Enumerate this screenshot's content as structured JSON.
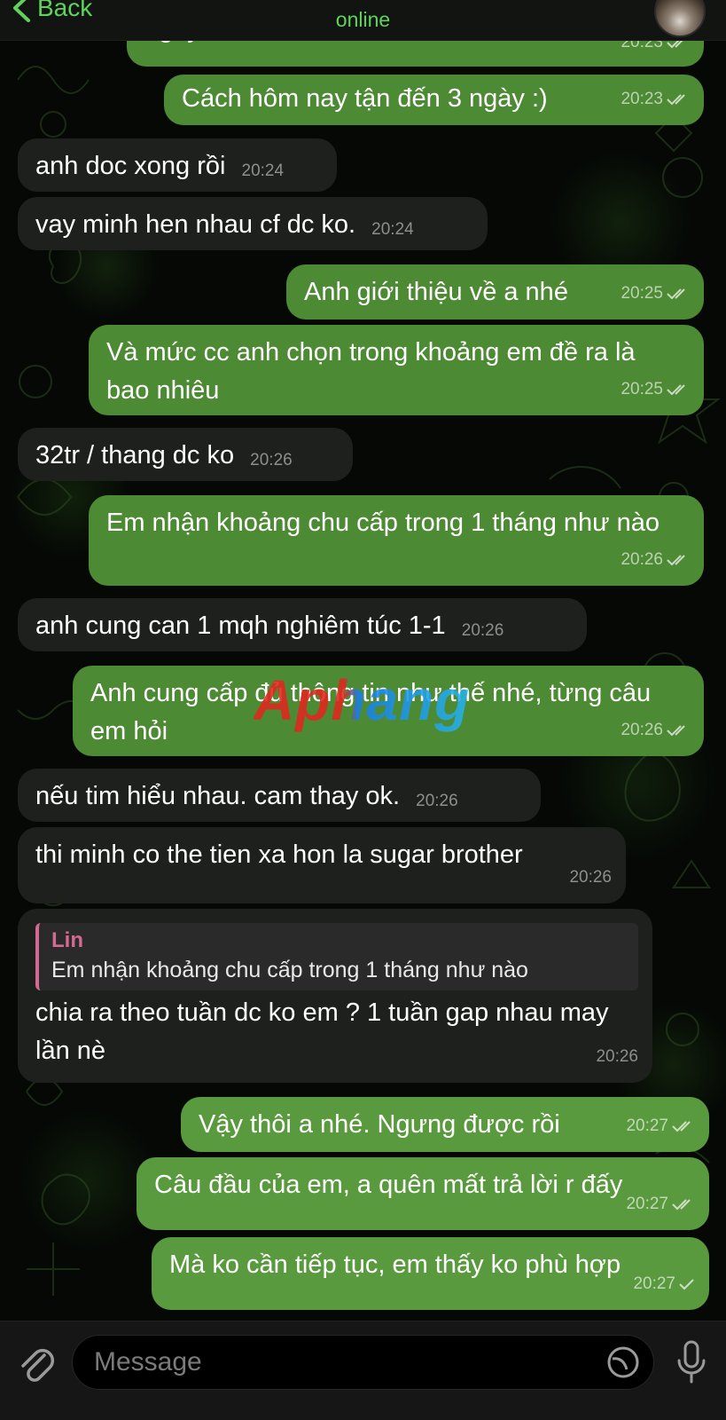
{
  "header": {
    "back_label": "Back",
    "status": "online"
  },
  "messages": [
    {
      "dir": "out",
      "text": "ngày nào nhỉ",
      "time": "20:23",
      "ticks": "double"
    },
    {
      "dir": "out",
      "text": "Cách hôm nay tận đến 3 ngày :)",
      "time": "20:23",
      "ticks": "double"
    },
    {
      "dir": "in",
      "text": "anh doc xong rồi",
      "time": "20:24"
    },
    {
      "dir": "in",
      "text": "vay minh hen nhau cf dc ko.",
      "time": "20:24"
    },
    {
      "dir": "out",
      "text": "Anh giới thiệu về a nhé",
      "time": "20:25",
      "ticks": "double"
    },
    {
      "dir": "out",
      "text": "Và mức cc anh chọn trong khoảng em đề ra là bao nhiêu",
      "time": "20:25",
      "ticks": "double"
    },
    {
      "dir": "in",
      "text": "32tr / thang dc ko",
      "time": "20:26"
    },
    {
      "dir": "out",
      "text": "Em nhận khoảng chu cấp trong 1 tháng như nào",
      "time": "20:26",
      "ticks": "double"
    },
    {
      "dir": "in",
      "text": "anh cung can 1 mqh nghiêm túc 1-1",
      "time": "20:26"
    },
    {
      "dir": "out",
      "text": "Anh cung cấp đủ thông tin như thế nhé, từng câu em hỏi",
      "time": "20:26",
      "ticks": "double"
    },
    {
      "dir": "in",
      "text": "nếu tim hiểu nhau. cam thay ok.",
      "time": "20:26"
    },
    {
      "dir": "in",
      "text": "thi minh co the tien xa hon la sugar brother",
      "time": "20:26"
    },
    {
      "dir": "in",
      "reply_name": "Lin",
      "reply_text": "Em nhận khoảng chu cấp trong 1 tháng như nào",
      "text": "chia ra theo tuần dc ko em ? 1 tuần gap nhau may lần nè",
      "time": "20:26"
    },
    {
      "dir": "out",
      "text": "Vậy thôi a nhé. Ngưng được rồi",
      "time": "20:27",
      "ticks": "double"
    },
    {
      "dir": "out",
      "text": "Câu đầu của em, a quên mất trả lời r đấy",
      "time": "20:27",
      "ticks": "double"
    },
    {
      "dir": "out",
      "text": "Mà ko cần tiếp tục, em thấy ko phù hợp",
      "time": "20:27",
      "ticks": "single"
    }
  ],
  "watermark": "Aphang",
  "input": {
    "placeholder": "Message"
  },
  "icons": {
    "back": "chevron-left-icon",
    "attach": "paperclip-icon",
    "sticker": "sticker-icon",
    "mic": "microphone-icon",
    "read": "double-check-icon",
    "sent": "check-icon"
  },
  "colors": {
    "accent": "#5fd35b",
    "outgoing_bubble": "#4d8a34",
    "incoming_bubble": "#1e201e",
    "reply_accent": "#d46a93"
  }
}
